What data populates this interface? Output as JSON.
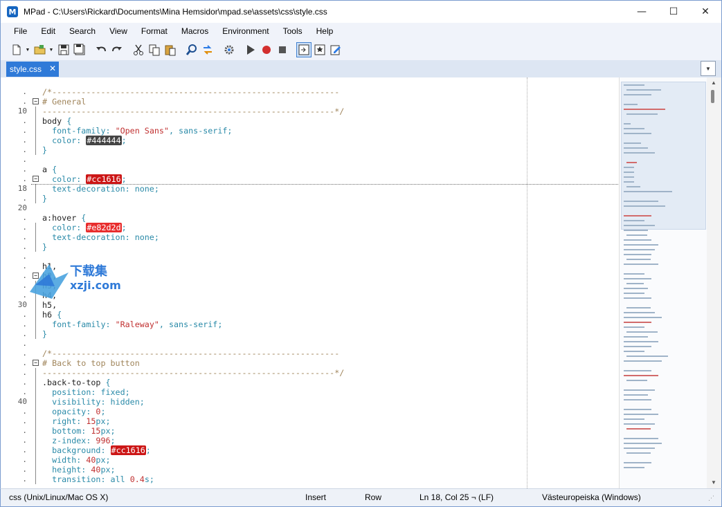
{
  "window": {
    "app_icon_letter": "M",
    "title": "MPad - C:\\Users\\Rickard\\Documents\\Mina Hemsidor\\mpad.se\\assets\\css\\style.css",
    "minimize": "—",
    "maximize": "☐",
    "close": "✕"
  },
  "menu": [
    "File",
    "Edit",
    "Search",
    "View",
    "Format",
    "Macros",
    "Environment",
    "Tools",
    "Help"
  ],
  "tabs": [
    {
      "label": "style.css",
      "close": "✕"
    }
  ],
  "tab_dropdown": "▼",
  "gutter_lines": [
    ".",
    ".",
    "10",
    ".",
    ".",
    ".",
    ".",
    ".",
    ".",
    ".",
    "18",
    ".",
    "20",
    ".",
    ".",
    ".",
    ".",
    ".",
    ".",
    ".",
    ".",
    ".",
    "30",
    ".",
    ".",
    ".",
    ".",
    ".",
    ".",
    ".",
    ".",
    ".",
    "40",
    ".",
    ".",
    ".",
    ".",
    ".",
    ".",
    ".",
    "."
  ],
  "code_lines": [
    [
      {
        "t": "/*-----------------------------------------------------------",
        "c": "comment"
      }
    ],
    [
      {
        "t": "# General",
        "c": "comment"
      }
    ],
    [
      {
        "t": "------------------------------------------------------------*/",
        "c": "comment"
      }
    ],
    [
      {
        "t": "body ",
        "c": "black"
      },
      {
        "t": "{",
        "c": "plain"
      }
    ],
    [
      {
        "t": "  font-family",
        "c": "prop"
      },
      {
        "t": ": ",
        "c": "plain"
      },
      {
        "t": "\"Open Sans\"",
        "c": "str"
      },
      {
        "t": ", sans-serif;",
        "c": "plain"
      }
    ],
    [
      {
        "t": "  color",
        "c": "prop"
      },
      {
        "t": ": ",
        "c": "plain"
      },
      {
        "t": "#444444",
        "c": "swatch",
        "bg": "#444444"
      },
      {
        "t": ";",
        "c": "plain"
      }
    ],
    [
      {
        "t": "}",
        "c": "plain"
      }
    ],
    [],
    [
      {
        "t": "a ",
        "c": "black"
      },
      {
        "t": "{",
        "c": "plain"
      }
    ],
    [
      {
        "t": "  color",
        "c": "prop"
      },
      {
        "t": ": ",
        "c": "plain"
      },
      {
        "t": "#cc1616",
        "c": "swatch",
        "bg": "#cc1616"
      },
      {
        "t": ";",
        "c": "plain"
      }
    ],
    [
      {
        "t": "  text-decoration",
        "c": "prop"
      },
      {
        "t": ": none;",
        "c": "plain"
      }
    ],
    [
      {
        "t": "}",
        "c": "plain"
      }
    ],
    [],
    [
      {
        "t": "a:hover ",
        "c": "black"
      },
      {
        "t": "{",
        "c": "plain"
      }
    ],
    [
      {
        "t": "  color",
        "c": "prop"
      },
      {
        "t": ": ",
        "c": "plain"
      },
      {
        "t": "#e82d2d",
        "c": "swatch",
        "bg": "#e82d2d"
      },
      {
        "t": ";",
        "c": "plain"
      }
    ],
    [
      {
        "t": "  text-decoration",
        "c": "prop"
      },
      {
        "t": ": none;",
        "c": "plain"
      }
    ],
    [
      {
        "t": "}",
        "c": "plain"
      }
    ],
    [],
    [
      {
        "t": "h1,",
        "c": "black"
      }
    ],
    [
      {
        "t": "h2,",
        "c": "black"
      }
    ],
    [
      {
        "t": "h3,",
        "c": "black"
      }
    ],
    [
      {
        "t": "h4,",
        "c": "black"
      }
    ],
    [
      {
        "t": "h5,",
        "c": "black"
      }
    ],
    [
      {
        "t": "h6 ",
        "c": "black"
      },
      {
        "t": "{",
        "c": "plain"
      }
    ],
    [
      {
        "t": "  font-family",
        "c": "prop"
      },
      {
        "t": ": ",
        "c": "plain"
      },
      {
        "t": "\"Raleway\"",
        "c": "str"
      },
      {
        "t": ", sans-serif;",
        "c": "plain"
      }
    ],
    [
      {
        "t": "}",
        "c": "plain"
      }
    ],
    [],
    [
      {
        "t": "/*-----------------------------------------------------------",
        "c": "comment"
      }
    ],
    [
      {
        "t": "# Back to top button",
        "c": "comment"
      }
    ],
    [
      {
        "t": "------------------------------------------------------------*/",
        "c": "comment"
      }
    ],
    [
      {
        "t": ".back-to-top ",
        "c": "black"
      },
      {
        "t": "{",
        "c": "plain"
      }
    ],
    [
      {
        "t": "  position",
        "c": "prop"
      },
      {
        "t": ": fixed;",
        "c": "plain"
      }
    ],
    [
      {
        "t": "  visibility",
        "c": "prop"
      },
      {
        "t": ": hidden;",
        "c": "plain"
      }
    ],
    [
      {
        "t": "  opacity",
        "c": "prop"
      },
      {
        "t": ": ",
        "c": "plain"
      },
      {
        "t": "0",
        "c": "num"
      },
      {
        "t": ";",
        "c": "plain"
      }
    ],
    [
      {
        "t": "  right",
        "c": "prop"
      },
      {
        "t": ": ",
        "c": "plain"
      },
      {
        "t": "15",
        "c": "num"
      },
      {
        "t": "px;",
        "c": "plain"
      }
    ],
    [
      {
        "t": "  bottom",
        "c": "prop"
      },
      {
        "t": ": ",
        "c": "plain"
      },
      {
        "t": "15",
        "c": "num"
      },
      {
        "t": "px;",
        "c": "plain"
      }
    ],
    [
      {
        "t": "  z-index",
        "c": "prop"
      },
      {
        "t": ": ",
        "c": "plain"
      },
      {
        "t": "996",
        "c": "num"
      },
      {
        "t": ";",
        "c": "plain"
      }
    ],
    [
      {
        "t": "  background",
        "c": "prop"
      },
      {
        "t": ": ",
        "c": "plain"
      },
      {
        "t": "#cc1616",
        "c": "swatch",
        "bg": "#cc1616"
      },
      {
        "t": ";",
        "c": "plain"
      }
    ],
    [
      {
        "t": "  width",
        "c": "prop"
      },
      {
        "t": ": ",
        "c": "plain"
      },
      {
        "t": "40",
        "c": "num"
      },
      {
        "t": "px;",
        "c": "plain"
      }
    ],
    [
      {
        "t": "  height",
        "c": "prop"
      },
      {
        "t": ": ",
        "c": "plain"
      },
      {
        "t": "40",
        "c": "num"
      },
      {
        "t": "px;",
        "c": "plain"
      }
    ],
    [
      {
        "t": "  transition",
        "c": "prop"
      },
      {
        "t": ": all ",
        "c": "plain"
      },
      {
        "t": "0.4",
        "c": "num"
      },
      {
        "t": "s;",
        "c": "plain"
      }
    ]
  ],
  "watermark": {
    "line1": "下载集",
    "line2": "xzji.com"
  },
  "status": {
    "language": "css (Unix/Linux/Mac OS X)",
    "insert_mode": "Insert",
    "selection_mode": "Row",
    "position": "Ln 18, Col 25 ¬ (LF)",
    "encoding": "Västeuropeiska (Windows)"
  },
  "colors": {
    "accent": "#2f7ad8",
    "comment": "#a0855b",
    "property": "#2a8aa8",
    "string": "#c03030"
  }
}
